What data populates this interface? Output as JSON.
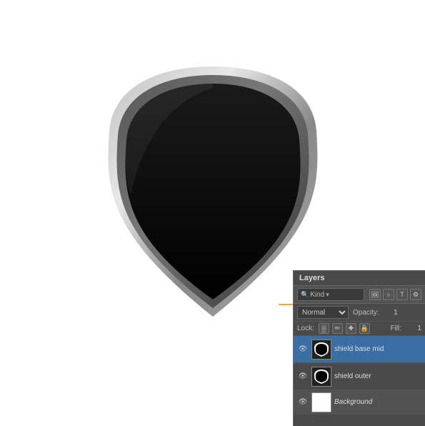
{
  "canvas": {
    "background": "#ffffff"
  },
  "layers_panel": {
    "title": "Layers",
    "search_placeholder": "Kind",
    "blend_mode": "Normal",
    "opacity_label": "Opacity:",
    "opacity_value": "1",
    "lock_label": "Lock:",
    "fill_label": "Fill:",
    "fill_value": "1",
    "icons": {
      "search": "🔍",
      "image": "🖼",
      "circle": "○",
      "text": "T",
      "settings": "⚙"
    },
    "layers": [
      {
        "id": "shield-base-mid",
        "name": "shield base mid",
        "visible": true,
        "active": true,
        "has_thumb": true,
        "thumb_type": "shield-dark"
      },
      {
        "id": "shield-outer",
        "name": "shield outer",
        "visible": true,
        "active": false,
        "has_thumb": true,
        "thumb_type": "shield-dark"
      },
      {
        "id": "background",
        "name": "Background",
        "visible": true,
        "active": false,
        "has_thumb": true,
        "thumb_type": "white",
        "is_bg": true,
        "italic": true
      }
    ]
  }
}
